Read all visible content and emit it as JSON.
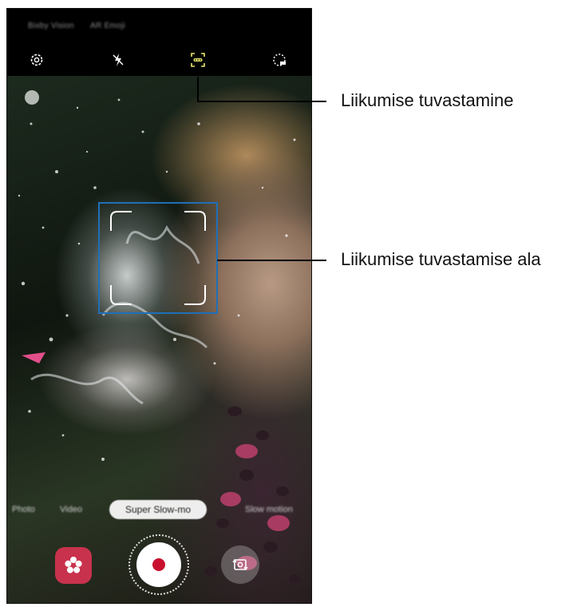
{
  "camera": {
    "top_modes": [
      "Bixby Vision",
      "AR Emoji"
    ],
    "toolbar": {
      "icons": [
        "settings-icon",
        "flash-off-icon",
        "motion-detection-icon",
        "speed-timer-icon"
      ]
    },
    "mode_selector": {
      "left_modes": [
        "Photo",
        "Video"
      ],
      "selected": "Super Slow-mo",
      "right_modes": [
        "Slow motion"
      ]
    },
    "controls": {
      "gallery_icon": "flower-icon",
      "record_icon": "record-icon",
      "switch_icon": "switch-camera-icon"
    }
  },
  "callouts": {
    "motion_detection": "Liikumise tuvastamine",
    "detection_area": "Liikumise tuvastamise ala"
  },
  "colors": {
    "accent_blue": "#1f6fb8",
    "record_red": "#c8102e",
    "gallery_pink": "#c8324c",
    "toolbar_highlight": "#e8e86a"
  }
}
